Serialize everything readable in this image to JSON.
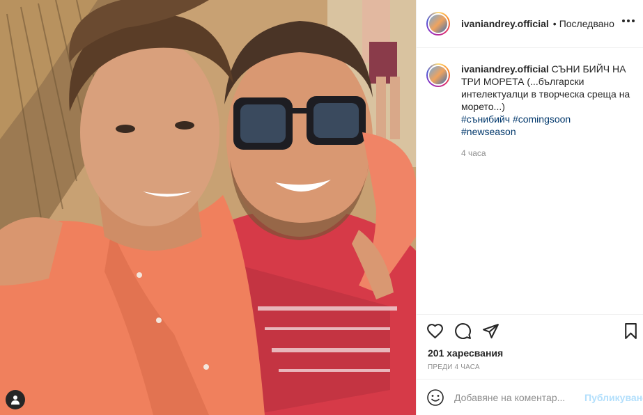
{
  "header": {
    "username": "ivaniandrey.official",
    "separator": "•",
    "follow_state": "Последвано"
  },
  "caption": {
    "username": "ivaniandrey.official",
    "text": "СЪНИ БИЙЧ НА ТРИ МОРЕТА (...български интелектуалци в творческа среща на морето...)",
    "hashtags": [
      "#сънибийч",
      "#comingsoon",
      "#newseason"
    ],
    "time": "4 часа"
  },
  "actions": {
    "like_icon": "heart-icon",
    "comment_icon": "comment-icon",
    "share_icon": "share-icon",
    "save_icon": "bookmark-icon"
  },
  "likes": "201 харесвания",
  "timestamp": "ПРЕДИ 4 ЧАСА",
  "comment": {
    "placeholder": "Добавяне на коментар...",
    "post_label": "Публикуване"
  },
  "colors": {
    "link": "#00376b",
    "muted": "#8e8e8e",
    "post_button_disabled": "#b2dffc",
    "border": "#efefef"
  }
}
